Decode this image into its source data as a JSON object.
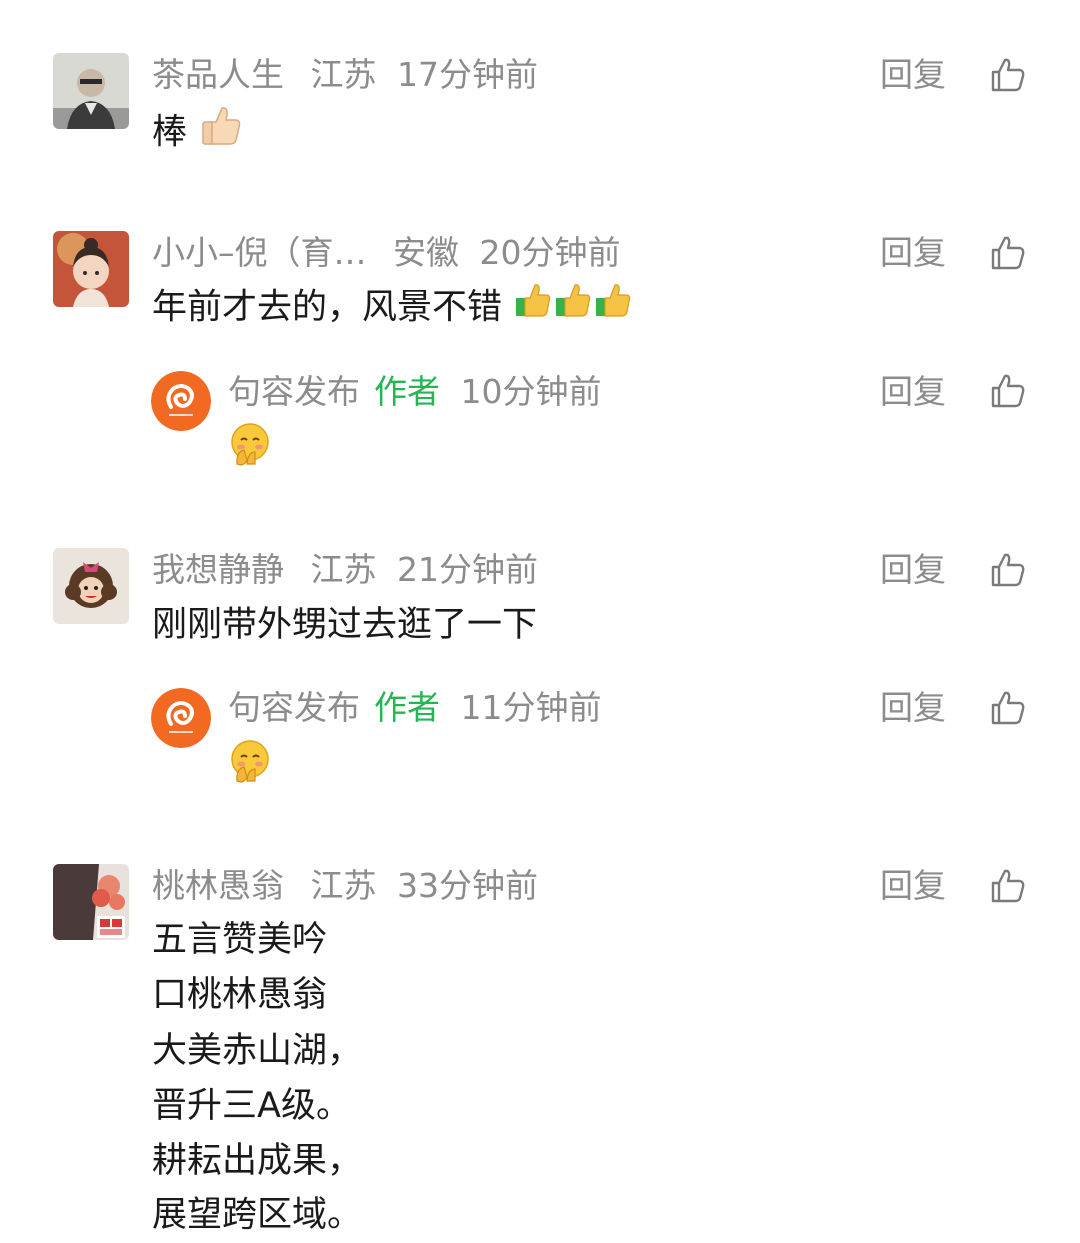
{
  "reply_label": "回复",
  "comments": [
    {
      "name": "茶品人生",
      "location": "江苏",
      "time": "17分钟前",
      "text": "棒"
    },
    {
      "name": "小小–倪（育…",
      "location": "安徽",
      "time": "20分钟前",
      "text": "年前才去的，风景不错",
      "reply": {
        "name": "句容发布",
        "tag": "作者",
        "time": "10分钟前"
      }
    },
    {
      "name": "我想静静",
      "location": "江苏",
      "time": "21分钟前",
      "text": "刚刚带外甥过去逛了一下",
      "reply": {
        "name": "句容发布",
        "tag": "作者",
        "time": "11分钟前"
      }
    },
    {
      "name": "桃林愚翁",
      "location": "江苏",
      "time": "33分钟前",
      "lines": [
        "五言赞美吟",
        "口桃林愚翁",
        "大美赤山湖，",
        "晋升三A级。",
        "耕耘出成果，",
        "展望跨区域。"
      ]
    }
  ],
  "colors": {
    "meta_gray": "#8c8c8c",
    "author_green": "#26b553",
    "text": "#1a1a1a",
    "author_logo": "#f26a22"
  },
  "icons": {
    "like": "thumbs-up-outline-icon",
    "emoji_thumb": "thumbs-up-emoji-icon",
    "emoji_shy": "shy-smile-emoji-icon"
  }
}
